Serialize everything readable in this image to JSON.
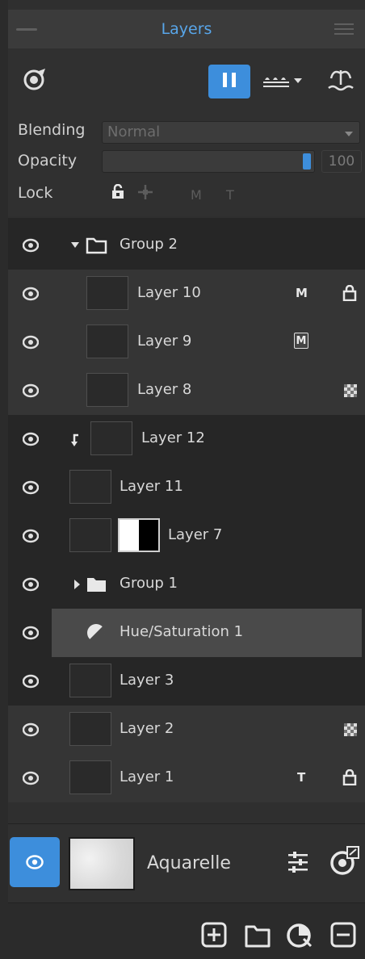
{
  "panel": {
    "title": "Layers",
    "accent_color": "#3d8edc",
    "title_color": "#58a6ea"
  },
  "toolbar": {
    "icons": [
      "layer-visibility-mode-icon",
      "pause-icon",
      "water-level-dropdown-icon",
      "fountain-icon"
    ]
  },
  "properties": {
    "blending_label": "Blending",
    "blending_value": "Normal",
    "opacity_label": "Opacity",
    "opacity_value": "100",
    "lock_label": "Lock",
    "lock_options": [
      "M",
      "T"
    ]
  },
  "layers": [
    {
      "name": "Group 2",
      "type": "group",
      "expanded": true
    },
    {
      "name": "Layer 10",
      "type": "layer",
      "badge": "M",
      "locked": true
    },
    {
      "name": "Layer 9",
      "type": "layer",
      "badge": "M"
    },
    {
      "name": "Layer 8",
      "type": "layer",
      "alpha_lock": true
    },
    {
      "name": "Layer 12",
      "type": "layer",
      "clipped": true
    },
    {
      "name": "Layer 11",
      "type": "layer"
    },
    {
      "name": "Layer 7",
      "type": "layer",
      "has_mask": true
    },
    {
      "name": "Group 1",
      "type": "group",
      "expanded": false
    },
    {
      "name": "Hue/Saturation 1",
      "type": "adjustment",
      "selected": true
    },
    {
      "name": "Layer 3",
      "type": "layer"
    },
    {
      "name": "Layer 2",
      "type": "layer",
      "alpha_lock": true
    },
    {
      "name": "Layer 1",
      "type": "layer",
      "badge": "T",
      "locked": true
    }
  ],
  "brush": {
    "name": "Aquarelle"
  },
  "footer": {
    "icons": [
      "add-layer-icon",
      "add-group-icon",
      "add-adjustment-icon",
      "delete-layer-icon"
    ]
  }
}
